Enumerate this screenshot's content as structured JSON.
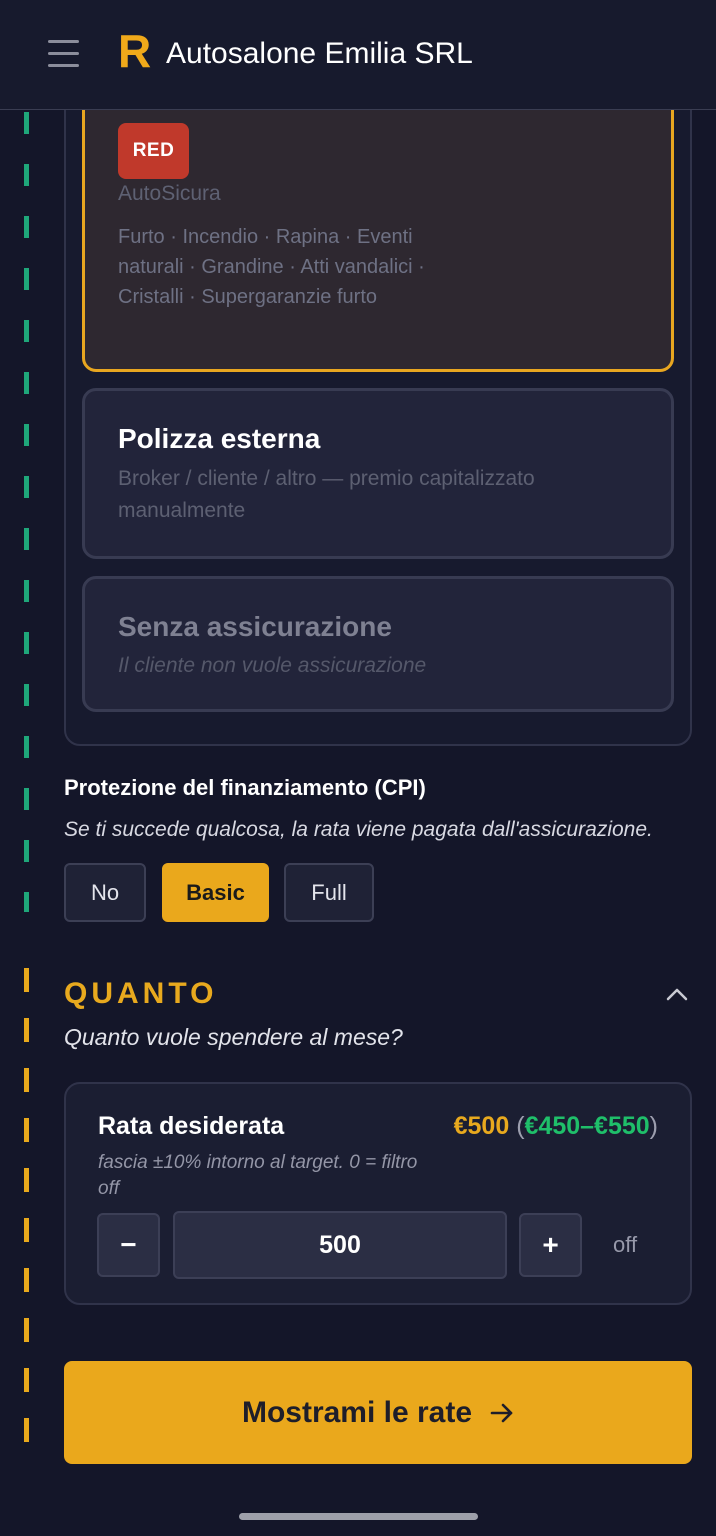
{
  "header": {
    "logo": "R",
    "title": "Autosalone Emilia SRL",
    "menu_icon": "hamburger-menu-icon"
  },
  "insurance_options": {
    "selected": {
      "badge": "RED",
      "provider": "AutoSicura",
      "coverage": "Furto · Incendio · Rapina · Eventi naturali · Grandine · Atti vandalici · Cristalli · Supergaranzie furto"
    },
    "external": {
      "title": "Polizza esterna",
      "subtitle": "Broker / cliente / altro — premio capitalizzato manualmente"
    },
    "none": {
      "title": "Senza assicurazione",
      "subtitle": "Il cliente non vuole assicurazione"
    }
  },
  "cpi": {
    "title": "Protezione del finanziamento (CPI)",
    "subtitle": "Se ti succede qualcosa, la rata viene pagata dall'assicurazione.",
    "options": [
      "No",
      "Basic",
      "Full"
    ],
    "selected": "Basic"
  },
  "quanto": {
    "title": "QUANTO",
    "subtitle": "Quanto vuole spendere al mese?",
    "rata_label": "Rata desiderata",
    "target": "€500",
    "paren_open": "(",
    "range": "€450–€550",
    "paren_close": ")",
    "help": "fascia ±10% intorno al target. 0 = filtro off",
    "minus": "−",
    "value": "500",
    "plus": "+",
    "off_label": "off"
  },
  "cta": {
    "label": "Mostrami le rate"
  },
  "colors": {
    "accent": "#eaa81c",
    "badge_red": "#c0392b",
    "range_green": "#1fbf6a",
    "rail_green": "#1fa77a",
    "background": "#141629"
  }
}
